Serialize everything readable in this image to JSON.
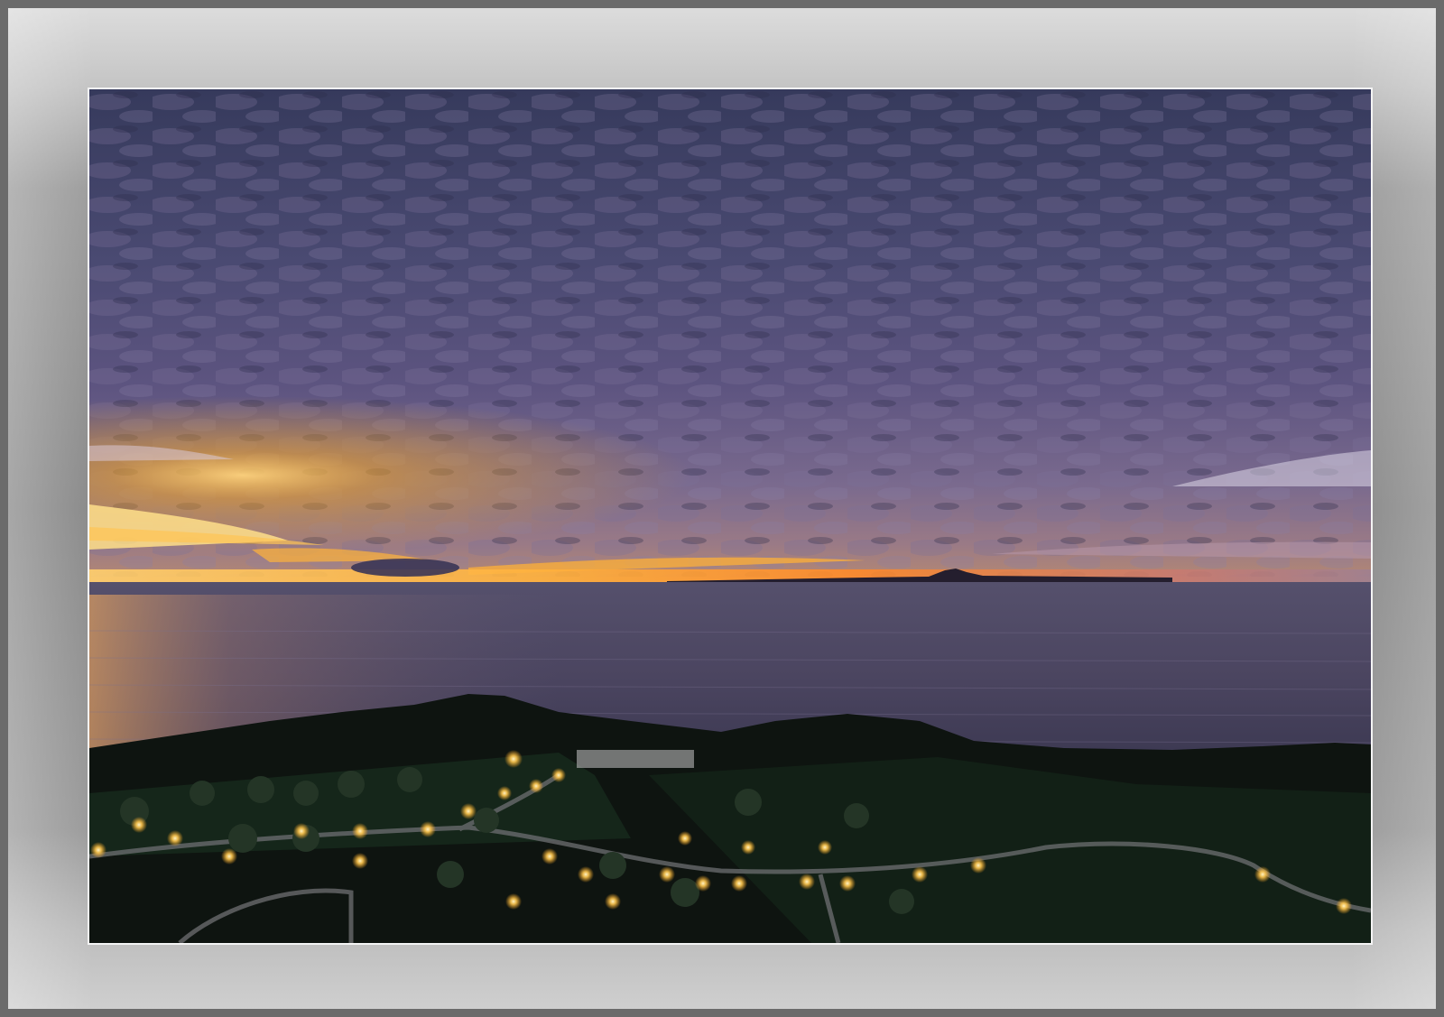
{
  "image": {
    "subject": "sunset-over-sea",
    "colors": {
      "mat": "#9a9a9a",
      "inner_border": "#f4f4f4",
      "sky_top": "#3a3a5e",
      "sky_mid": "#5a4f78",
      "sunset_glow": "#f5a623",
      "sea": "#4a445e",
      "land": "#0f1610",
      "lights": "#ffd27a"
    }
  }
}
